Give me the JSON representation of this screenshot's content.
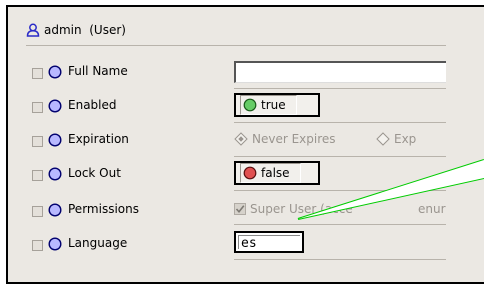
{
  "title": {
    "icon": "user-icon",
    "text": "admin  (User)"
  },
  "properties": [
    {
      "label": "Full Name",
      "editor": "text",
      "value": ""
    },
    {
      "label": "Enabled",
      "editor": "boolean",
      "value": "true",
      "color": "#66cc66"
    },
    {
      "label": "Expiration",
      "editor": "radio",
      "options": [
        "Never Expires",
        "Exp"
      ]
    },
    {
      "label": "Lock Out",
      "editor": "boolean",
      "value": "false",
      "color": "#e05050"
    },
    {
      "label": "Permissions",
      "editor": "checkbox",
      "value": "Super User (acce",
      "clipped_tail": "enur"
    },
    {
      "label": "Language",
      "editor": "text",
      "value": "es"
    }
  ],
  "colors": {
    "panel_bg": "#ebe8e3",
    "slot_circle": "#b8b8ff",
    "callout_line": "#00cc00"
  }
}
